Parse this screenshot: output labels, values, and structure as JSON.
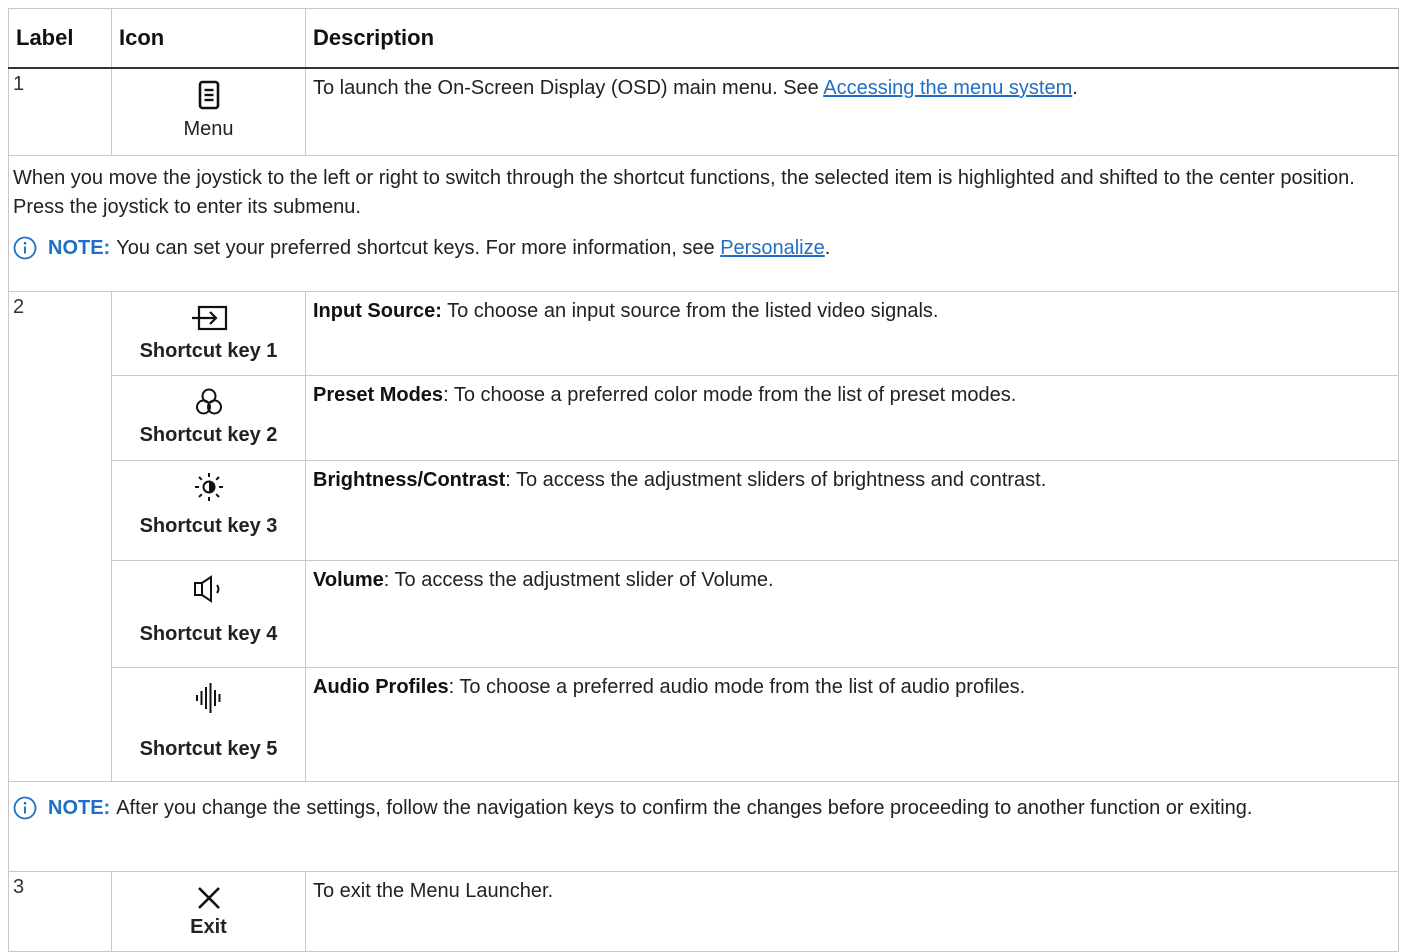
{
  "table": {
    "headers": {
      "label": "Label",
      "icon": "Icon",
      "description": "Description"
    },
    "row1": {
      "label": "1",
      "icon_name": "menu-icon",
      "icon_caption": "Menu",
      "text_before_link": "To launch the On-Screen Display (OSD) main menu. See ",
      "link_text": "Accessing the menu system",
      "text_after_link": "."
    },
    "intro": {
      "text": "When you move the joystick to the left or right to switch through the shortcut functions, the selected item is highlighted and shifted to the center position. Press the joystick to enter its submenu.",
      "note_label": "NOTE:",
      "note_text": "You can set your preferred shortcut keys. For more information, see ",
      "note_link": "Personalize",
      "note_after": "."
    },
    "row2": {
      "label": "2",
      "shortcuts": [
        {
          "icon_name": "input-source-icon",
          "caption": "Shortcut key 1",
          "title": "Input Source:",
          "text": " To choose an input source from the listed video signals."
        },
        {
          "icon_name": "preset-modes-icon",
          "caption": "Shortcut key 2",
          "title": "Preset Modes",
          "text": ": To choose a preferred color mode from the list of preset modes."
        },
        {
          "icon_name": "brightness-contrast-icon",
          "caption": "Shortcut key 3",
          "title": "Brightness/Contrast",
          "text": ": To access the adjustment sliders of brightness and contrast."
        },
        {
          "icon_name": "volume-icon",
          "caption": "Shortcut key 4",
          "title": "Volume",
          "text": ": To access the adjustment slider of Volume."
        },
        {
          "icon_name": "audio-profiles-icon",
          "caption": "Shortcut key 5",
          "title": "Audio Profiles",
          "text": ": To choose a preferred audio mode from the list of audio profiles."
        }
      ]
    },
    "note2": {
      "note_label": "NOTE:",
      "note_text": "After you change the settings, follow the navigation keys to confirm the changes before proceeding to another function or exiting."
    },
    "row3": {
      "label": "3",
      "icon_name": "exit-icon",
      "icon_caption": "Exit",
      "text": "To exit the Menu Launcher."
    }
  },
  "colors": {
    "link": "#1f6fc7",
    "note_label": "#1f6fc7",
    "border": "#c8c8c8",
    "header_rule": "#333333"
  }
}
